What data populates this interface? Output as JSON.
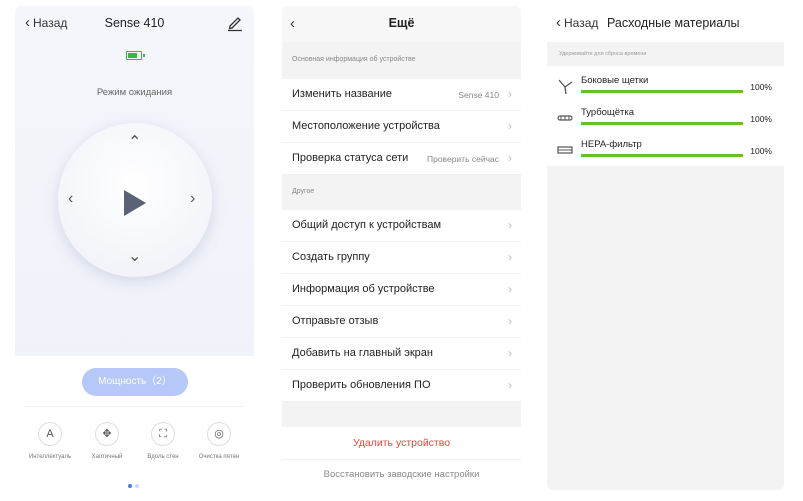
{
  "screen1": {
    "back_label": "Назад",
    "title": "Sense 410",
    "status": "Режим ожидания",
    "power_button": "Мощность（2）",
    "modes": [
      {
        "icon": "A",
        "label": "Интеллектуаль"
      },
      {
        "icon": "✥",
        "label": "Хаотичный"
      },
      {
        "icon": "⛶",
        "label": "Вдоль стен"
      },
      {
        "icon": "◎",
        "label": "Очистка пятен"
      }
    ],
    "colors": {
      "accent": "#b5c8f7",
      "battery": "#39b54a"
    }
  },
  "screen2": {
    "title": "Ещё",
    "section1_header": "Основная информация об устройстве",
    "section1_rows": [
      {
        "label": "Изменить название",
        "value": "Sense 410"
      },
      {
        "label": "Местоположение устройства",
        "value": ""
      },
      {
        "label": "Проверка статуса сети",
        "value": "Проверить сейчас"
      }
    ],
    "section2_header": "Другое",
    "section2_rows": [
      {
        "label": "Общий доступ к устройствам"
      },
      {
        "label": "Создать группу"
      },
      {
        "label": "Информация об устройстве"
      },
      {
        "label": "Отправьте отзыв"
      },
      {
        "label": "Добавить на главный экран"
      },
      {
        "label": "Проверить обновления ПО"
      }
    ],
    "delete_label": "Удалить устройство",
    "reset_label": "Восстановить заводские настройки",
    "colors": {
      "danger": "#e8453c"
    }
  },
  "screen3": {
    "back_label": "Назад",
    "title": "Расходные материалы",
    "hint": "Удерживайте для сброса времени",
    "items": [
      {
        "name": "Боковые щетки",
        "percent": "100%",
        "level": 1.0
      },
      {
        "name": "Турбощётка",
        "percent": "100%",
        "level": 1.0
      },
      {
        "name": "HEPA-фильтр",
        "percent": "100%",
        "level": 1.0
      }
    ],
    "colors": {
      "progress": "#6bbf1e"
    }
  }
}
